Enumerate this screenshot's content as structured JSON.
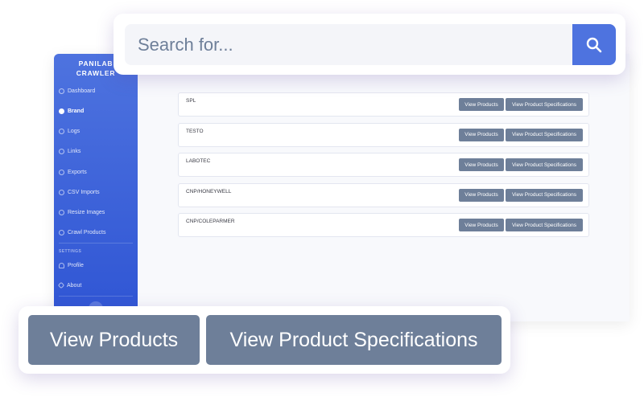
{
  "search": {
    "placeholder": "Search for..."
  },
  "sidebar": {
    "brand": "PANILAB\nCRAWLER",
    "items": [
      {
        "label": "Dashboard",
        "icon": "gauge-icon"
      },
      {
        "label": "Brand",
        "icon": "check-circle-icon",
        "active": true
      },
      {
        "label": "Logs",
        "icon": "clock-icon"
      },
      {
        "label": "Links",
        "icon": "link-icon"
      },
      {
        "label": "Exports",
        "icon": "export-icon"
      },
      {
        "label": "CSV Imports",
        "icon": "import-icon"
      },
      {
        "label": "Resize Images",
        "icon": "image-icon"
      },
      {
        "label": "Crawl Products",
        "icon": "spider-icon"
      }
    ],
    "settings_label": "SETTINGS",
    "settings_items": [
      {
        "label": "Profile",
        "icon": "user-icon"
      },
      {
        "label": "About",
        "icon": "link-icon"
      }
    ]
  },
  "brands": [
    {
      "name": "SPL"
    },
    {
      "name": "TESTO"
    },
    {
      "name": "LABOTEC"
    },
    {
      "name": "CNP/HONEYWELL"
    },
    {
      "name": "CNP/COLEPARMER"
    }
  ],
  "buttons": {
    "view_products": "View Products",
    "view_product_specifications": "View Product Specifications"
  },
  "colors": {
    "sidebar": "#4e73df",
    "button": "#6e7f99",
    "search_button": "#4e73df"
  }
}
